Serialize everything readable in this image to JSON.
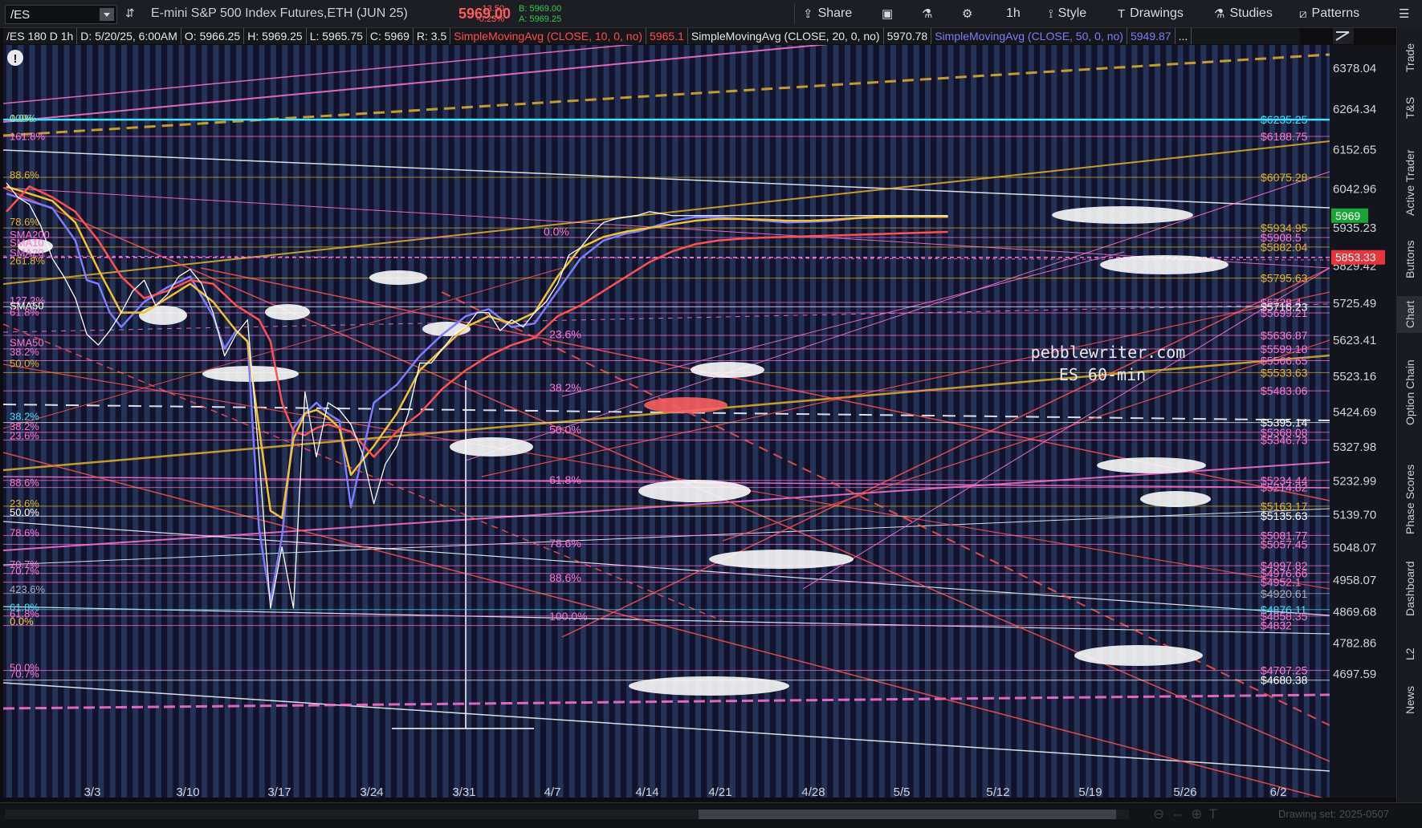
{
  "toolbar": {
    "symbol": "/ES",
    "description": "E-mini S&P 500 Index Futures,ETH (JUN 25)",
    "last": "5969.00",
    "change": "-13.50",
    "change_pct": "-0.23%",
    "bid": "B: 5969.00",
    "ask": "A: 5969.25",
    "share_label": "Share",
    "timeframe": "1h",
    "style_label": "Style",
    "drawings_label": "Drawings",
    "studies_label": "Studies",
    "patterns_label": "Patterns"
  },
  "studybar": {
    "header": "/ES 180 D 1h",
    "date": "D: 5/20/25, 6:00AM",
    "open": "O: 5966.25",
    "high": "H: 5969.25",
    "low": "L: 5965.75",
    "close": "C: 5969",
    "range": "R: 3.5",
    "sma10_label": "SimpleMovingAvg (CLOSE, 10, 0, no)",
    "sma10_value": "5965.1",
    "sma20_label": "SimpleMovingAvg (CLOSE, 20, 0, no)",
    "sma20_value": "5970.78",
    "sma50_label": "SimpleMovingAvg (CLOSE, 50, 0, no)",
    "sma50_value": "5949.87",
    "more": "..."
  },
  "sidebar_tabs": [
    "Trade",
    "T&S",
    "Active Trader",
    "Buttons",
    "Chart",
    "Option Chain",
    "Phase Scores",
    "Dashboard",
    "L2",
    "News"
  ],
  "bottom": {
    "drawing_set": "Drawing set: 2025-0507"
  },
  "watermark": {
    "line1": "pebblewriter.com",
    "line2": "ES 60-min"
  },
  "colors": {
    "background": "#12122a",
    "stripe": "#2b3d66",
    "sma10": "#ff5050",
    "sma20": "#f2c230",
    "sma50": "#7b7dff",
    "price": "#ffffff",
    "fib_pink": "#ff74d4",
    "fib_gold": "#e0b12a",
    "cyan": "#40e0ff"
  },
  "chart_data": {
    "type": "line",
    "title": "/ES 180 D 1h",
    "y_ticks": [
      6378.04,
      6264.34,
      6152.65,
      6042.96,
      5935.23,
      5829.42,
      5725.49,
      5623.41,
      5523.16,
      5424.69,
      5327.98,
      5232.99,
      5139.7,
      5048.07,
      4958.07,
      4869.68,
      4782.86,
      4697.59
    ],
    "ylim": [
      4620,
      6430
    ],
    "x_ticks": [
      "3/3",
      "3/10",
      "3/17",
      "3/24",
      "3/31",
      "4/7",
      "4/14",
      "4/21",
      "4/28",
      "5/5",
      "5/12",
      "5/19",
      "5/26",
      "6/2"
    ],
    "price_markers": [
      {
        "label": "5969",
        "value": 5969,
        "color": "#1aa636"
      },
      {
        "label": "5853.33",
        "value": 5853.33,
        "color": "#e5343a"
      }
    ],
    "right_levels": [
      {
        "label": "$6235.25",
        "value": 6235.25,
        "color": "#40e0ff"
      },
      {
        "label": "$6188.75",
        "value": 6188.75,
        "color": "#ff74d4"
      },
      {
        "label": "$6075.28",
        "value": 6075.28,
        "color": "#e0b12a"
      },
      {
        "label": "$5934.95",
        "value": 5934.95,
        "color": "#e0b12a"
      },
      {
        "label": "$5908.5",
        "value": 5908.5,
        "color": "#ff74d4"
      },
      {
        "label": "$5882.04",
        "value": 5882.04,
        "color": "#e0b12a"
      },
      {
        "label": "$5795.63",
        "value": 5795.63,
        "color": "#e0b12a"
      },
      {
        "label": "$5728.4",
        "value": 5728.4,
        "color": "#ff74d4"
      },
      {
        "label": "$5716.23",
        "value": 5716.23,
        "color": "#ffffff"
      },
      {
        "label": "$5699.21",
        "value": 5699.21,
        "color": "#ff74d4"
      },
      {
        "label": "$5636.87",
        "value": 5636.87,
        "color": "#ff74d4"
      },
      {
        "label": "$5599.18",
        "value": 5599.18,
        "color": "#ff74d4"
      },
      {
        "label": "$5566.65",
        "value": 5566.65,
        "color": "#ff74d4"
      },
      {
        "label": "$5533.63",
        "value": 5533.63,
        "color": "#e0b12a"
      },
      {
        "label": "$5483.06",
        "value": 5483.06,
        "color": "#ff74d4"
      },
      {
        "label": "$5395.14",
        "value": 5395.14,
        "color": "#ffffff"
      },
      {
        "label": "$5368.08",
        "value": 5368.08,
        "color": "#ff74d4"
      },
      {
        "label": "$5346.73",
        "value": 5346.73,
        "color": "#ff74d4"
      },
      {
        "label": "$5234.44",
        "value": 5234.44,
        "color": "#ff74d4"
      },
      {
        "label": "$5214.82",
        "value": 5214.82,
        "color": "#ff74d4"
      },
      {
        "label": "$5163.17",
        "value": 5163.17,
        "color": "#e0b12a"
      },
      {
        "label": "$5135.63",
        "value": 5135.63,
        "color": "#ffffff"
      },
      {
        "label": "$5081.77",
        "value": 5081.77,
        "color": "#ff74d4"
      },
      {
        "label": "$5057.45",
        "value": 5057.45,
        "color": "#ff74d4"
      },
      {
        "label": "$4997.82",
        "value": 4997.82,
        "color": "#ff74d4"
      },
      {
        "label": "$4976.66",
        "value": 4976.66,
        "color": "#ff74d4"
      },
      {
        "label": "$4952.1",
        "value": 4952.1,
        "color": "#ff74d4"
      },
      {
        "label": "$4920.61",
        "value": 4920.61,
        "color": "#a8a8b8"
      },
      {
        "label": "$4876.11",
        "value": 4876.11,
        "color": "#40e0ff"
      },
      {
        "label": "$4858.35",
        "value": 4858.35,
        "color": "#ff74d4"
      },
      {
        "label": "$4832",
        "value": 4832,
        "color": "#ff74d4"
      },
      {
        "label": "$4707.25",
        "value": 4707.25,
        "color": "#ff74d4"
      },
      {
        "label": "$4680.38",
        "value": 4680.38,
        "color": "#ffffff"
      }
    ],
    "left_labels": [
      {
        "label": "0.0%",
        "value": 6240,
        "color": "#ffd040"
      },
      {
        "label": "100%",
        "value": 6240,
        "color": "#40e0ff"
      },
      {
        "label": "161.8%",
        "value": 6190,
        "color": "#ff74d4"
      },
      {
        "label": "88.6%",
        "value": 6083,
        "color": "#e0b12a"
      },
      {
        "label": "78.6%",
        "value": 5953,
        "color": "#e0b12a"
      },
      {
        "label": "SMA200",
        "value": 5917,
        "color": "#ff74d4"
      },
      {
        "label": "SMA10",
        "value": 5895,
        "color": "#ff74d4"
      },
      {
        "label": "SMA20",
        "value": 5867,
        "color": "#ff74d4"
      },
      {
        "label": "261.8%",
        "value": 5845,
        "color": "#e0b12a"
      },
      {
        "label": "127.2%",
        "value": 5735,
        "color": "#ff74d4"
      },
      {
        "label": "SMA50",
        "value": 5720,
        "color": "#ffffff"
      },
      {
        "label": "61.8%",
        "value": 5702,
        "color": "#ff74d4"
      },
      {
        "label": "SMA50",
        "value": 5618,
        "color": "#ff74d4"
      },
      {
        "label": "38.2%",
        "value": 5592,
        "color": "#ff74d4"
      },
      {
        "label": "50.0%",
        "value": 5560,
        "color": "#e0b12a"
      },
      {
        "label": "38.2%",
        "value": 5413,
        "color": "#40e0ff"
      },
      {
        "label": "38.2%",
        "value": 5385,
        "color": "#ff74d4"
      },
      {
        "label": "23.6%",
        "value": 5360,
        "color": "#ff74d4"
      },
      {
        "label": "88.6%",
        "value": 5230,
        "color": "#ff74d4"
      },
      {
        "label": "23.6%",
        "value": 5172,
        "color": "#e0b12a"
      },
      {
        "label": "50.0%",
        "value": 5147,
        "color": "#ffffff"
      },
      {
        "label": "78.6%",
        "value": 5090,
        "color": "#ff74d4"
      },
      {
        "label": "70.7%",
        "value": 5003,
        "color": "#ff74d4"
      },
      {
        "label": "70.7%",
        "value": 4985,
        "color": "#ff74d4"
      },
      {
        "label": "423.6%",
        "value": 4933,
        "color": "#a8a8b8"
      },
      {
        "label": "61.8%",
        "value": 4883,
        "color": "#40e0ff"
      },
      {
        "label": "61.8%",
        "value": 4866,
        "color": "#ff74d4"
      },
      {
        "label": "0.0%",
        "value": 4845,
        "color": "#ffd040"
      },
      {
        "label": "50.0%",
        "value": 4717,
        "color": "#ff74d4"
      },
      {
        "label": "70.7%",
        "value": 4699,
        "color": "#ff74d4"
      }
    ],
    "mid_labels": [
      {
        "label": "0.0%",
        "x": 26.5,
        "value": 5925,
        "color": "#ff74d4"
      },
      {
        "label": "23.6%",
        "x": 27,
        "value": 5640,
        "color": "#ff74d4"
      },
      {
        "label": "38.2%",
        "x": 27,
        "value": 5492,
        "color": "#ff74d4"
      },
      {
        "label": "50.0%",
        "x": 27,
        "value": 5375,
        "color": "#ff74d4"
      },
      {
        "label": "61.8%",
        "x": 27,
        "value": 5236,
        "color": "#ff74d4"
      },
      {
        "label": "78.6%",
        "x": 27,
        "value": 5060,
        "color": "#ff74d4"
      },
      {
        "label": "88.6%",
        "x": 27,
        "value": 4965,
        "color": "#ff74d4"
      },
      {
        "label": "100.0%",
        "x": 27,
        "value": 4858,
        "color": "#ff74d4"
      }
    ],
    "series": [
      {
        "name": "SimpleMovingAvg (CLOSE, 10, 0, no)",
        "color": "#7b7dff",
        "x": [
          0,
          2,
          4,
          6,
          7,
          8,
          9,
          10,
          12,
          14,
          16,
          18,
          19,
          20,
          21,
          22,
          23,
          24,
          25,
          26,
          27,
          28,
          29,
          30,
          32,
          34,
          36,
          38,
          40,
          42,
          44,
          46,
          48,
          50,
          52,
          53,
          54,
          55,
          56,
          57,
          58,
          60,
          62,
          64,
          66,
          68,
          70,
          72,
          74,
          75,
          76,
          77,
          78,
          79,
          80,
          81,
          82
        ],
        "values": [
          6030,
          6010,
          5990,
          5900,
          5790,
          5780,
          5700,
          5660,
          5730,
          5770,
          5800,
          5690,
          5600,
          5650,
          5620,
          5100,
          4900,
          5080,
          5380,
          5420,
          5450,
          5420,
          5400,
          5160,
          5450,
          5500,
          5580,
          5640,
          5690,
          5710,
          5660,
          5670,
          5760,
          5850,
          5900,
          5910,
          5920,
          5925,
          5935,
          5945,
          5955,
          5965,
          5965,
          5960,
          5955,
          5950,
          5952,
          5955,
          5962,
          5965,
          5966,
          5966,
          5966,
          5966,
          5966,
          5966,
          5966
        ]
      },
      {
        "name": "SimpleMovingAvg (CLOSE, 20, 0, no)",
        "color": "#f2c230",
        "x": [
          0,
          2,
          4,
          6,
          8,
          10,
          12,
          14,
          16,
          18,
          20,
          21,
          22,
          23,
          24,
          25,
          26,
          27,
          28,
          29,
          30,
          32,
          34,
          36,
          38,
          40,
          42,
          44,
          46,
          48,
          50,
          52,
          54,
          56,
          58,
          60,
          62,
          64,
          66,
          68,
          70,
          72,
          74,
          76,
          78,
          80,
          82
        ],
        "values": [
          6050,
          6030,
          6010,
          5950,
          5820,
          5700,
          5700,
          5740,
          5780,
          5730,
          5650,
          5620,
          5380,
          5150,
          5130,
          5350,
          5420,
          5430,
          5410,
          5380,
          5250,
          5330,
          5420,
          5540,
          5600,
          5660,
          5690,
          5670,
          5700,
          5800,
          5880,
          5910,
          5925,
          5935,
          5945,
          5955,
          5960,
          5960,
          5958,
          5955,
          5955,
          5958,
          5962,
          5965,
          5966,
          5966,
          5966
        ]
      },
      {
        "name": "SimpleMovingAvg (CLOSE, 50, 0, no)",
        "color": "#ff5050",
        "x": [
          0,
          2,
          4,
          6,
          8,
          10,
          12,
          14,
          16,
          18,
          20,
          22,
          23,
          24,
          25,
          26,
          27,
          28,
          30,
          32,
          34,
          36,
          38,
          40,
          42,
          44,
          46,
          48,
          50,
          52,
          54,
          56,
          58,
          60,
          62,
          64,
          66,
          68,
          70,
          72,
          74,
          76,
          78,
          80,
          82
        ],
        "values": [
          5980,
          6050,
          6020,
          5980,
          5900,
          5800,
          5740,
          5760,
          5790,
          5780,
          5720,
          5680,
          5620,
          5450,
          5370,
          5360,
          5380,
          5390,
          5370,
          5300,
          5370,
          5420,
          5490,
          5540,
          5580,
          5610,
          5630,
          5690,
          5720,
          5760,
          5800,
          5840,
          5870,
          5890,
          5900,
          5905,
          5908,
          5910,
          5912,
          5914,
          5916,
          5918,
          5920,
          5922,
          5924
        ]
      },
      {
        "name": "Price",
        "color": "#ffffff",
        "x": [
          0,
          1,
          2,
          3,
          4,
          5,
          6,
          7,
          8,
          9,
          10,
          11,
          12,
          13,
          14,
          15,
          16,
          17,
          18,
          19,
          20,
          21,
          22,
          23,
          24,
          25,
          26,
          27,
          28,
          29,
          30,
          31,
          32,
          33,
          34,
          35,
          36,
          37,
          38,
          39,
          40,
          41,
          42,
          43,
          44,
          45,
          46,
          47,
          48,
          49,
          50,
          51,
          52,
          53,
          54,
          55,
          56,
          57,
          58,
          59,
          60,
          61,
          62,
          63,
          64,
          65,
          66,
          67,
          68,
          69,
          70,
          71,
          72,
          73,
          74,
          75,
          76,
          77,
          78,
          79,
          80,
          81,
          82
        ],
        "values": [
          6060,
          6020,
          6000,
          5940,
          5850,
          5800,
          5740,
          5640,
          5610,
          5650,
          5700,
          5760,
          5790,
          5720,
          5750,
          5800,
          5820,
          5780,
          5700,
          5580,
          5640,
          5680,
          5300,
          4880,
          5050,
          4880,
          5480,
          5300,
          5450,
          5430,
          5390,
          5310,
          5170,
          5280,
          5330,
          5420,
          5560,
          5560,
          5600,
          5640,
          5660,
          5700,
          5700,
          5650,
          5680,
          5660,
          5700,
          5730,
          5780,
          5860,
          5880,
          5920,
          5950,
          5960,
          5965,
          5970,
          5980,
          5975,
          5969,
          5969,
          5969,
          5969,
          5969,
          5969,
          5969,
          5969,
          5969,
          5969,
          5969,
          5969,
          5969,
          5969,
          5969,
          5969,
          5969,
          5969,
          5969,
          5969,
          5969,
          5969,
          5969,
          5969,
          5969
        ]
      }
    ],
    "grid": true
  }
}
